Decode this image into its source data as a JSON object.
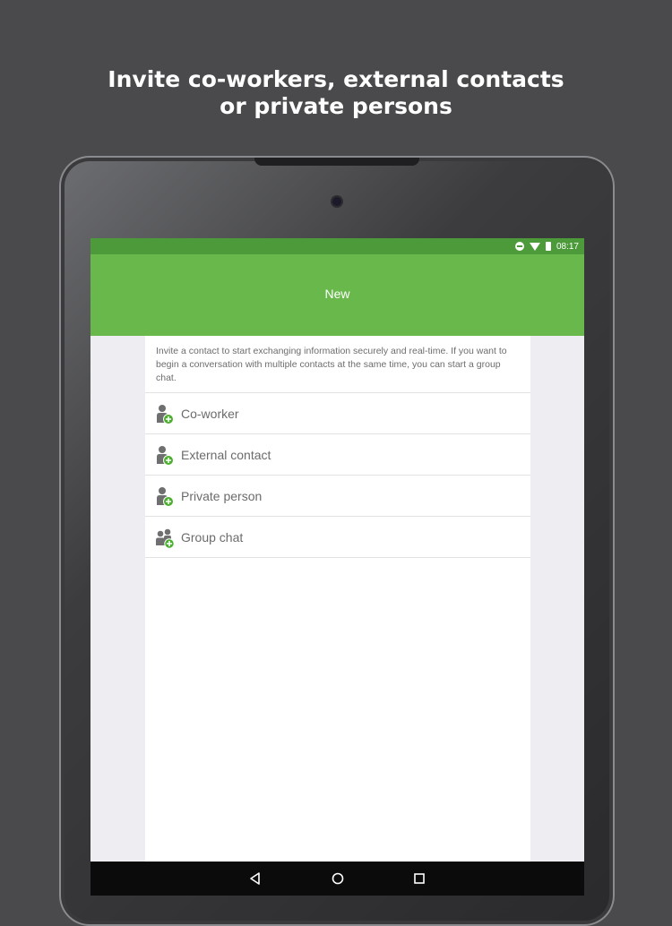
{
  "headline": {
    "line1": "Invite co-workers, external contacts",
    "line2": "or private persons"
  },
  "status_bar": {
    "time": "08:17",
    "icons": [
      "do-not-disturb-icon",
      "wifi-icon",
      "battery-icon"
    ]
  },
  "app_bar": {
    "title": "New"
  },
  "intro_text": "Invite a contact to start exchanging information securely and real-time. If you want to begin a conversation with multiple contacts at the same time, you can start a group chat.",
  "options": [
    {
      "label": "Co-worker",
      "icon": "add-person-icon"
    },
    {
      "label": "External contact",
      "icon": "add-person-icon"
    },
    {
      "label": "Private person",
      "icon": "add-person-icon"
    },
    {
      "label": "Group chat",
      "icon": "add-group-icon"
    }
  ],
  "nav_bar": {
    "buttons": [
      "back-icon",
      "home-icon",
      "recents-icon"
    ]
  },
  "colors": {
    "background": "#4a4a4c",
    "status_bar": "#4c9a3a",
    "app_bar": "#69b84b",
    "accent_badge": "#4caf2f",
    "icon_gray": "#6f6f6f"
  }
}
